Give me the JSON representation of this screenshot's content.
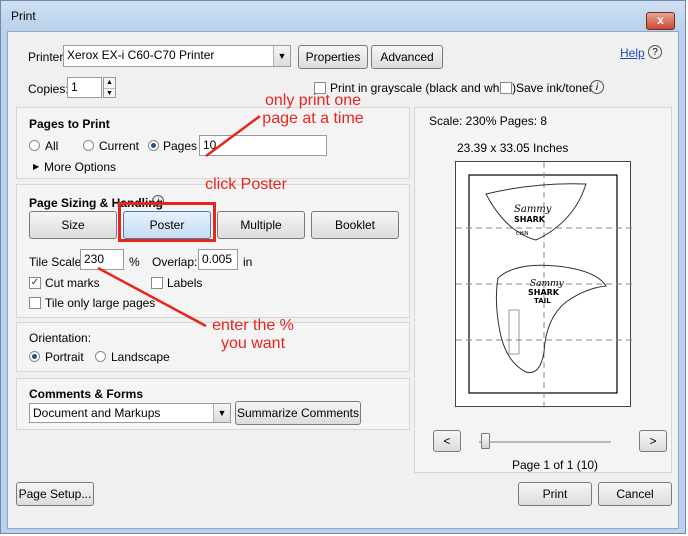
{
  "window": {
    "title": "Print",
    "close_symbol": "x"
  },
  "printer": {
    "label": "Printer:",
    "selected": "Xerox EX-i C60-C70 Printer",
    "properties_button": "Properties",
    "advanced_button": "Advanced",
    "help_link": "Help"
  },
  "copies": {
    "label": "Copies:",
    "value": "1"
  },
  "options": {
    "grayscale_label": "Print in grayscale (black and white)",
    "save_ink_label": "Save ink/toner"
  },
  "pages_to_print": {
    "title": "Pages to Print",
    "all_label": "All",
    "current_label": "Current",
    "pages_label": "Pages",
    "pages_value": "10",
    "more_options_label": "More Options"
  },
  "page_sizing": {
    "title": "Page Sizing & Handling",
    "size_button": "Size",
    "poster_button": "Poster",
    "multiple_button": "Multiple",
    "booklet_button": "Booklet",
    "tile_scale_label": "Tile Scale:",
    "tile_scale_value": "230",
    "tile_scale_unit": "%",
    "overlap_label": "Overlap:",
    "overlap_value": "0.005",
    "overlap_unit": "in",
    "cut_marks_label": "Cut marks",
    "labels_label": "Labels",
    "tile_large_label": "Tile only large pages"
  },
  "orientation": {
    "title": "Orientation:",
    "portrait_label": "Portrait",
    "landscape_label": "Landscape"
  },
  "comments_forms": {
    "title": "Comments & Forms",
    "selected": "Document and Markups",
    "summarize_button": "Summarize Comments"
  },
  "preview": {
    "scale_text": "Scale: 230% Pages: 8",
    "dimensions_text": "23.39 x 33.05 Inches",
    "page_indicator": "Page 1 of 1 (10)",
    "prev_button": "<",
    "next_button": ">",
    "content_text_1": "Sammy",
    "content_text_2": "SHARK",
    "content_text_3": "CHIN",
    "content_text_4": "Sammy",
    "content_text_5": "SHARK",
    "content_text_6": "TAIL",
    "slider_value": 0
  },
  "footer": {
    "page_setup_button": "Page Setup...",
    "print_button": "Print",
    "cancel_button": "Cancel"
  },
  "annotations": {
    "note1_line1": "only print one",
    "note1_line2": "page at a time",
    "note2": "click Poster",
    "note3_line1": "enter the %",
    "note3_line2": "you want",
    "color": "#e8251c"
  }
}
